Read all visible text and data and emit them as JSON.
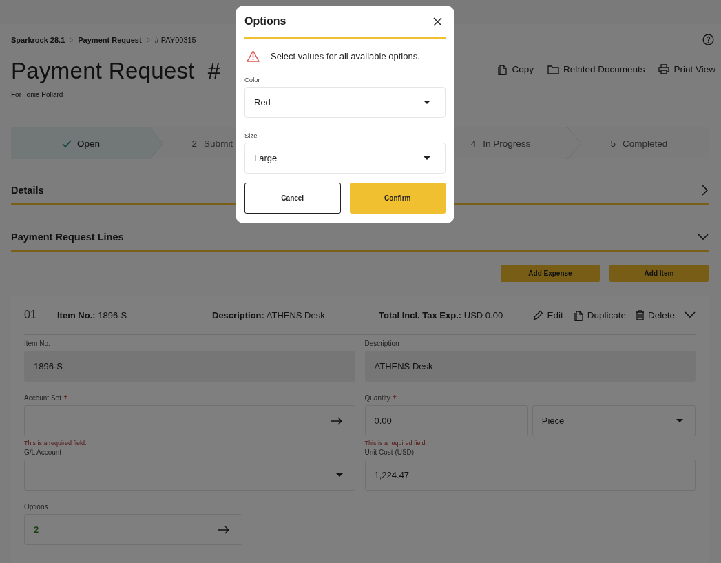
{
  "breadcrumb": [
    "Sparkrock 28.1",
    "Payment Request",
    "# PAY00315"
  ],
  "page_title": "Payment Request  #",
  "subtitle": "For Tonie Pollard",
  "actions": [
    {
      "label": "Copy",
      "kind": "copy"
    },
    {
      "label": "Related Documents",
      "kind": "folder"
    },
    {
      "label": "Print View",
      "kind": "print"
    }
  ],
  "steps": [
    {
      "label": "Open",
      "done": true
    },
    {
      "number": "2",
      "label": "Submit",
      "done": false
    },
    {
      "number": "4",
      "label": "In Progress",
      "done": false
    },
    {
      "number": "5",
      "label": "Completed",
      "done": false
    }
  ],
  "sections": [
    {
      "title": "Details",
      "expanded": false
    },
    {
      "title": "Payment Request Lines",
      "expanded": true
    }
  ],
  "line_buttons": [
    "Add Expense",
    "Add Item"
  ],
  "line": {
    "number": "01",
    "summary": [
      {
        "label": "Item No.:",
        "value": "1896-S"
      },
      {
        "label": "Description:",
        "value": "ATHENS Desk"
      },
      {
        "label": "Total Incl. Tax Exp.:",
        "value": "USD 0.00"
      }
    ],
    "actions": [
      {
        "label": "Edit",
        "kind": "edit"
      },
      {
        "label": "Duplicate",
        "kind": "duplicate"
      },
      {
        "label": "Delete",
        "kind": "delete"
      }
    ],
    "expanded": true,
    "fields": [
      {
        "label": "Item No.",
        "kind": "readonly",
        "value": "1896-S"
      },
      {
        "label": "Description",
        "kind": "readonly",
        "value": "ATHENS Desk"
      },
      {
        "label": "Account Set",
        "kind": "lookup",
        "required": true,
        "error": "This is a required field."
      },
      {
        "label": "Quantity",
        "kind": "quantity",
        "required": true,
        "value": "0.00",
        "unit": "Piece",
        "error": "This is a required field."
      },
      {
        "label": "G/L Account",
        "kind": "select"
      },
      {
        "label": "Unit Cost (USD)",
        "kind": "text",
        "value": "1,224.47"
      },
      {
        "label": "Options",
        "kind": "counter",
        "value": "2"
      }
    ]
  },
  "dialog": {
    "title": "Options",
    "warning": "Select values for all available options.",
    "fields": [
      {
        "label": "Color",
        "value": "Red"
      },
      {
        "label": "Size",
        "value": "Large"
      }
    ],
    "buttons": [
      {
        "label": "Cancel",
        "kind": "secondary"
      },
      {
        "label": "Confirm",
        "kind": "primary"
      }
    ]
  }
}
